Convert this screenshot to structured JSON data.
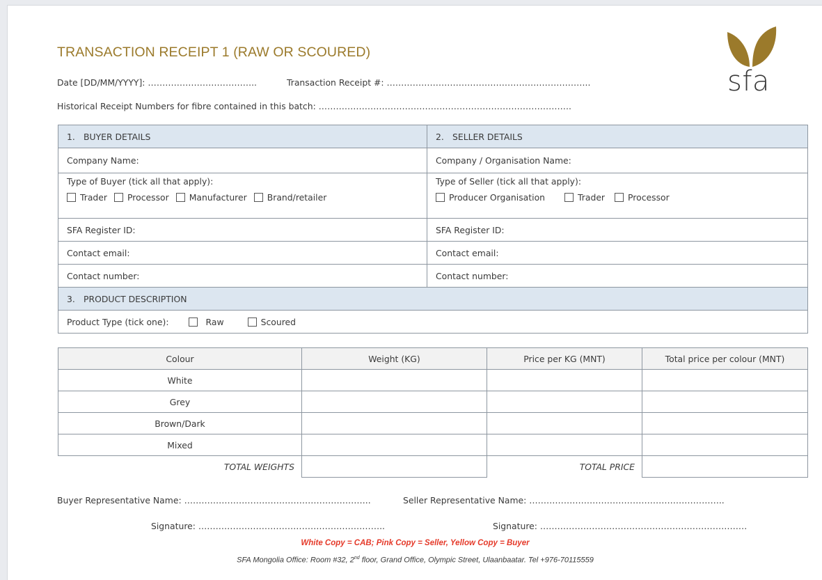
{
  "title": "TRANSACTION RECEIPT 1 (RAW OR SCOURED)",
  "header": {
    "date_label": "Date [DD/MM/YYYY]: ………………………………..",
    "receipt_label": "Transaction Receipt #: ……………………………………………………………..",
    "historical_label": "Historical Receipt Numbers for fibre contained in this batch: ……………………………………………………………………………."
  },
  "logo": {
    "text": "sfa",
    "leaf_color": "#9b7a2b"
  },
  "buyer": {
    "heading_num": "1.",
    "heading": "BUYER DETAILS",
    "company": "Company Name:",
    "type_label": "Type of Buyer (tick all that apply):",
    "types": [
      "Trader",
      "Processor",
      "Manufacturer",
      "Brand/retailer"
    ],
    "register": "SFA Register ID:",
    "email": "Contact email:",
    "number": "Contact number:"
  },
  "seller": {
    "heading_num": "2.",
    "heading": "SELLER DETAILS",
    "company": "Company / Organisation Name:",
    "type_label": "Type of Seller (tick all that apply):",
    "types": [
      "Producer Organisation",
      "Trader",
      "Processor"
    ],
    "register": "SFA Register ID:",
    "email": "Contact email:",
    "number": "Contact number:"
  },
  "product": {
    "heading_num": "3.",
    "heading": "PRODUCT DESCRIPTION",
    "type_label": "Product Type (tick one):",
    "types": [
      "Raw",
      "Scoured"
    ],
    "columns": [
      "Colour",
      "Weight (KG)",
      "Price per KG (MNT)",
      "Total price per colour (MNT)"
    ],
    "rows": [
      "White",
      "Grey",
      "Brown/Dark",
      "Mixed"
    ],
    "total_weights": "TOTAL WEIGHTS",
    "total_price": "TOTAL PRICE"
  },
  "signatures": {
    "buyer_rep": "Buyer Representative Name: ………………………………………………………..",
    "seller_rep": "Seller Representative Name: …………………………………………………………..",
    "buyer_sig": "Signature: ………………………………………………………..",
    "seller_sig": "Signature: ………………………………………………………………"
  },
  "footer": {
    "copies": "White Copy = CAB; Pink Copy = Seller, Yellow Copy = Buyer",
    "office_prefix": "SFA Mongolia Office: Room #32, 2",
    "office_sup": "nd",
    "office_suffix": " floor, Grand Office, Olympic Street, Ulaanbaatar. Tel +976-70115559",
    "note_color": "#e53a2a"
  }
}
